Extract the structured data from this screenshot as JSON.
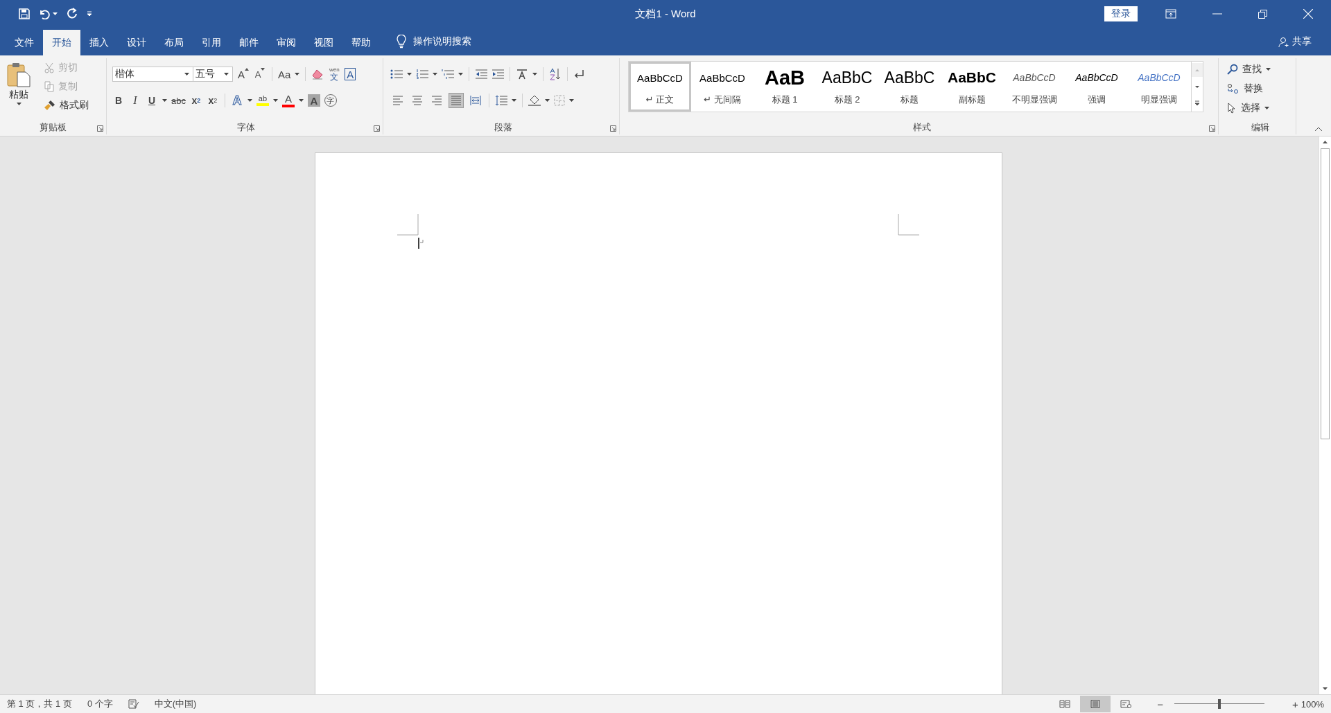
{
  "window": {
    "title": "文档1  -  Word",
    "login": "登录",
    "share": "共享"
  },
  "tabs": [
    {
      "label": "文件",
      "selected": false
    },
    {
      "label": "开始",
      "selected": true
    },
    {
      "label": "插入",
      "selected": false
    },
    {
      "label": "设计",
      "selected": false
    },
    {
      "label": "布局",
      "selected": false
    },
    {
      "label": "引用",
      "selected": false
    },
    {
      "label": "邮件",
      "selected": false
    },
    {
      "label": "审阅",
      "selected": false
    },
    {
      "label": "视图",
      "selected": false
    },
    {
      "label": "帮助",
      "selected": false
    }
  ],
  "tell_me": "操作说明搜索",
  "clipboard": {
    "label": "剪贴板",
    "paste": "粘贴",
    "commands": [
      {
        "kind": "cut",
        "label": "剪切",
        "disabled": true
      },
      {
        "kind": "copy",
        "label": "复制",
        "disabled": true
      },
      {
        "kind": "painter",
        "label": "格式刷",
        "disabled": false
      }
    ]
  },
  "font": {
    "label": "字体",
    "font_name": "楷体",
    "font_size": "五号",
    "row1": [
      {
        "kind": "grow",
        "glyph": "A"
      },
      {
        "kind": "shrink",
        "glyph": "A"
      },
      {
        "kind": "case",
        "glyph": "Aa"
      },
      {
        "kind": "clear"
      },
      {
        "kind": "phonetic",
        "glyph": "文",
        "ruby": "wén"
      },
      {
        "kind": "border",
        "glyph": "A"
      }
    ],
    "row2": [
      {
        "kind": "bold",
        "glyph": "B"
      },
      {
        "kind": "italic",
        "glyph": "I"
      },
      {
        "kind": "underline",
        "glyph": "U"
      },
      {
        "kind": "strike",
        "glyph": "abc"
      },
      {
        "kind": "sub",
        "glyph": "x",
        "script": "2"
      },
      {
        "kind": "sup",
        "glyph": "x",
        "script": "2"
      },
      {
        "kind": "effects",
        "glyph": "A"
      },
      {
        "kind": "highlight",
        "glyph": "ab",
        "color": "#ffff00"
      },
      {
        "kind": "fontcolor",
        "glyph": "A",
        "color": "#ff0000"
      },
      {
        "kind": "shading",
        "glyph": "A"
      },
      {
        "kind": "enclose",
        "glyph": "字"
      }
    ]
  },
  "paragraph": {
    "label": "段落",
    "alignments": [
      {
        "kind": "left",
        "selected": false
      },
      {
        "kind": "center",
        "selected": false
      },
      {
        "kind": "right",
        "selected": false
      },
      {
        "kind": "justify",
        "selected": true
      },
      {
        "kind": "distribute",
        "selected": false
      }
    ]
  },
  "styles": {
    "label": "样式",
    "items": [
      {
        "preview": "AaBbCcD",
        "name": "↵ 正文",
        "kind": "normal",
        "selected": true
      },
      {
        "preview": "AaBbCcD",
        "name": "↵ 无间隔",
        "kind": "normal",
        "selected": false
      },
      {
        "preview": "AaB",
        "name": "标题 1",
        "kind": "h1",
        "selected": false
      },
      {
        "preview": "AaBbC",
        "name": "标题 2",
        "kind": "h2",
        "selected": false
      },
      {
        "preview": "AaBbC",
        "name": "标题",
        "kind": "title",
        "selected": false
      },
      {
        "preview": "AaBbC",
        "name": "副标题",
        "kind": "subtitle",
        "selected": false
      },
      {
        "preview": "AaBbCcD",
        "name": "不明显强调",
        "kind": "subtle",
        "selected": false
      },
      {
        "preview": "AaBbCcD",
        "name": "强调",
        "kind": "emphasis",
        "selected": false
      },
      {
        "preview": "AaBbCcD",
        "name": "明显强调",
        "kind": "intense",
        "selected": false
      }
    ]
  },
  "editing": {
    "label": "编辑",
    "find": "查找",
    "replace": "替换",
    "select": "选择"
  },
  "status_bar": {
    "page": "第 1 页，共 1 页",
    "words": "0 个字",
    "language": "中文(中国)",
    "views": [
      {
        "kind": "read",
        "selected": false
      },
      {
        "kind": "print",
        "selected": true
      },
      {
        "kind": "web",
        "selected": false
      }
    ],
    "zoom_out": "−",
    "zoom_in": "+",
    "zoom": {
      "level": 0.5
    },
    "zoom_label": "100%"
  }
}
